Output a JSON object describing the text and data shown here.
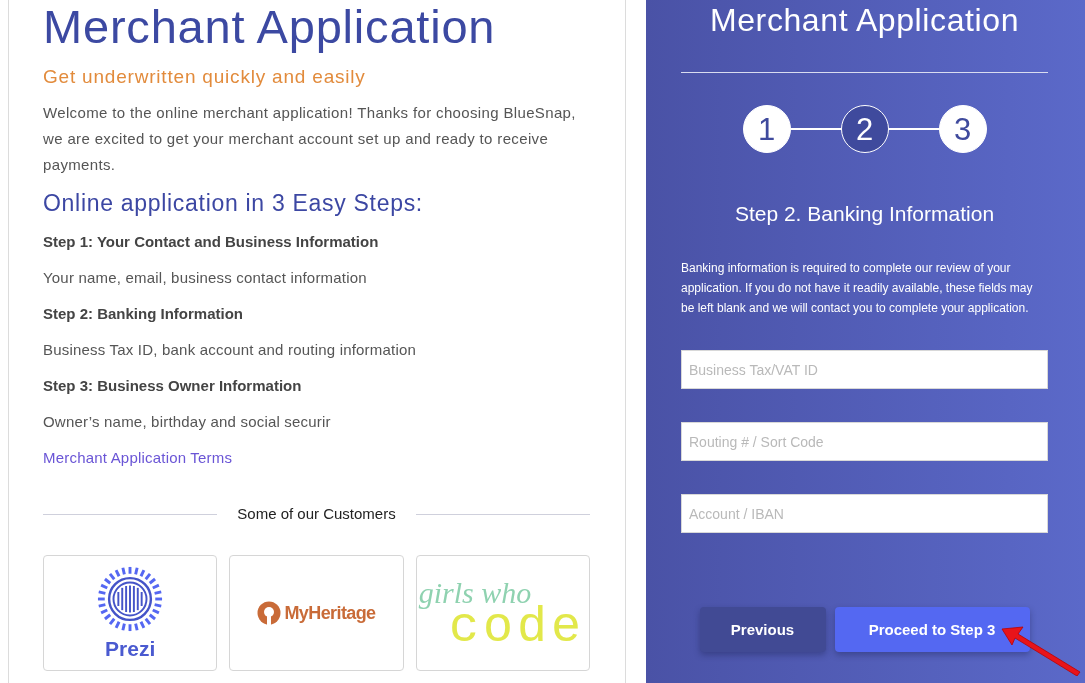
{
  "intro": {
    "title": "Merchant Application",
    "subtitle": "Get underwritten quickly and easily",
    "body": "Welcome to the online merchant application! Thanks for choosing BlueSnap, we are excited to get your merchant account set up and ready to receive payments."
  },
  "overview": {
    "heading": "Online application in 3 Easy Steps:",
    "items": [
      {
        "title": "Step 1: Your Contact and Business Information",
        "description": "Your name, email, business contact information"
      },
      {
        "title": "Step 2: Banking Information",
        "description": "Business Tax ID, bank account and routing information"
      },
      {
        "title": "Step 3: Business Owner Information",
        "description": "Owner’s name, birthday and social securir"
      }
    ],
    "terms_link": "Merchant Application Terms"
  },
  "customers": {
    "heading": "Some of our Customers",
    "logos": [
      {
        "kind": "prezi",
        "lines": [
          "Prezi"
        ]
      },
      {
        "kind": "myheritage",
        "lines": [
          "MyHeritage"
        ]
      },
      {
        "kind": "girlswhocode",
        "lines": [
          "girls who",
          "code"
        ]
      }
    ]
  },
  "form": {
    "title": "Merchant Application",
    "steps": [
      {
        "label": "1",
        "selected": false
      },
      {
        "label": "2",
        "selected": true
      },
      {
        "label": "3",
        "selected": false
      }
    ],
    "step_heading": "Step 2. Banking Information",
    "note": "Banking information is required to complete our review of your application. If you do not have it readily available, these fields may be left blank and we will contact you to complete your application.",
    "fields": [
      {
        "placeholder": "Business Tax/VAT ID"
      },
      {
        "placeholder": "Routing # / Sort Code"
      },
      {
        "placeholder": "Account / IBAN"
      }
    ],
    "buttons": [
      {
        "label": "Previous",
        "kind": "secondary"
      },
      {
        "label": "Proceed to Step 3",
        "kind": "primary"
      }
    ]
  }
}
